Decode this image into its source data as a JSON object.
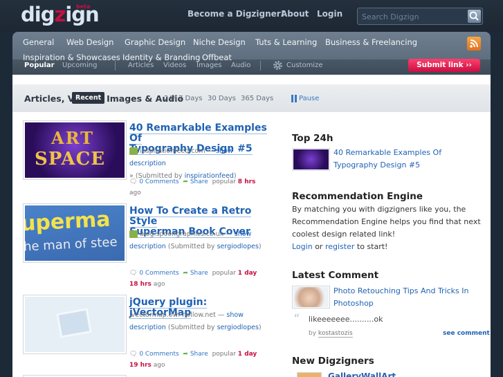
{
  "header": {
    "logo_text_a": "dig",
    "logo_text_z": "z",
    "logo_text_b": "ign",
    "logo_badge": "beta",
    "links": [
      "Become a Digzigner!",
      "About",
      "Login"
    ],
    "search_placeholder": "Search Digzign"
  },
  "nav": {
    "categories_row1": [
      "General",
      "Web Design",
      "Graphic Design",
      "Niche Design",
      "Tuts & Learning",
      "Business & Freelancing"
    ],
    "categories_row2": [
      "Inspiration & Showcases",
      "Identity & Branding",
      "Offbeat"
    ],
    "sort": [
      "Popular",
      "Upcoming"
    ],
    "types": [
      "Articles",
      "Videos",
      "Images",
      "Audio"
    ],
    "customize": "Customize",
    "submit": "Submit link  ››"
  },
  "filter": {
    "title": "Articles, Videos, Images & Audio",
    "badge": "Recent",
    "periods": [
      "24h",
      "7 Days",
      "30 Days",
      "365 Days"
    ],
    "pause": "Pause"
  },
  "articles": [
    {
      "title_l1": "40 Remarkable Examples Of",
      "title_l2": "Typography Design #5",
      "domain": "inspirationfeed.com",
      "show": "show description",
      "show_cont": "»",
      "submitted": "(Submitted by",
      "user": "inspirationfeed",
      "comments": "0 Comments",
      "share": "Share",
      "popular": "popular",
      "age": "8 hrs",
      "ago": "ago"
    },
    {
      "title_l1": "How To Create a Retro Style",
      "title_l2": "Superman Book Cover",
      "domain": "blog.spoongraphics.co.uk",
      "show": "show",
      "show_cont": "description",
      "submitted": "(Submitted by",
      "user": "sergiodlopes",
      "comments": "0 Comments",
      "share": "Share",
      "popular": "popular",
      "age": "1 day",
      "age2": "18 hrs",
      "ago": "ago"
    },
    {
      "title_l1": "jQuery plugin: jVectorMap",
      "domain": "jvectormap.owl-hollow.net",
      "show": "show",
      "show_cont": "description",
      "submitted": "(Submitted by",
      "user": "sergiodlopes",
      "comments": "0 Comments",
      "share": "Share",
      "popular": "popular",
      "age": "1 day",
      "age2": "19 hrs",
      "ago": "ago"
    }
  ],
  "sidebar": {
    "top24_title": "Top 24h",
    "top24_item": "40 Remarkable Examples Of Typography Design #5",
    "rec_title": "Recommendation Engine",
    "rec_text": "By matching you with digzigners like you, the Recommendation Engine helps you find that next coolest design related link!",
    "rec_login": "Login",
    "rec_or": "or",
    "rec_register": "register",
    "rec_start": "to start!",
    "latest_title": "Latest Comment",
    "latest_link": "Photo Retouching Tips And Tricks In Photoshop",
    "latest_quote": "likeeeeeee..........ok",
    "latest_by": "by",
    "latest_user": "kostastozis",
    "see_comment": "see comment",
    "new_title": "New Digzigners",
    "new_user": "GalleryWallArt"
  },
  "thumb_texts": {
    "art1_a": "ART",
    "art1_b": "SPACE",
    "art2_a": "uperma",
    "art2_b": "he man of stee"
  },
  "colors": {
    "accent": "#c70f42",
    "link": "#1f62b4",
    "header_bg": "#1c2a38"
  }
}
